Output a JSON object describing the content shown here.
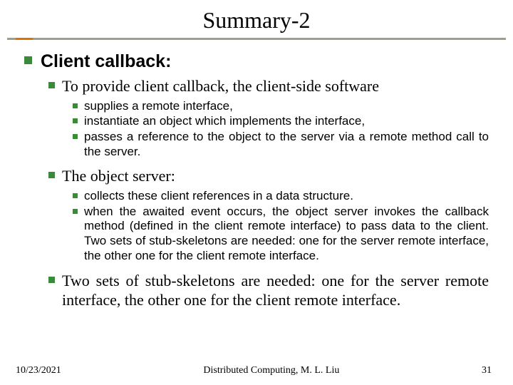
{
  "title": "Summary-2",
  "heading": "Client callback:",
  "sec1": {
    "lead": "To provide client callback, the client-side software",
    "items": [
      "supplies a remote interface,",
      "instantiate an object which implements the interface,",
      "passes a reference to the object to the server via a remote method  call to the server."
    ]
  },
  "sec2": {
    "lead": "The object server:",
    "items": [
      "collects these client references in a data structure.",
      "when the awaited event occurs, the object server invokes the callback method (defined in the client remote interface) to pass data to the client. Two sets of stub-skeletons are needed: one for the server remote interface, the other one for the client remote interface."
    ]
  },
  "closing": "Two sets of stub-skeletons are needed: one for the server remote interface, the other one for the client remote interface.",
  "footer": {
    "date": "10/23/2021",
    "center": "Distributed Computing, M. L. Liu",
    "page": "31"
  }
}
